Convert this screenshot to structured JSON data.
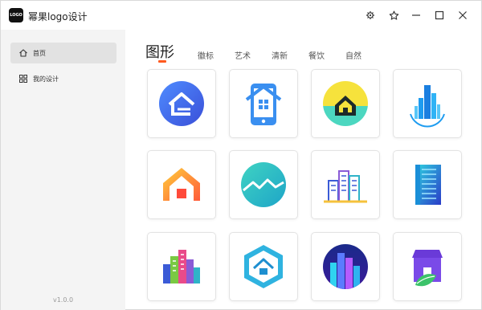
{
  "app": {
    "logo_text": "LOGO",
    "title": "幂果logo设计"
  },
  "titlebar": {
    "icons": [
      "settings-icon",
      "star-icon",
      "minimize-icon",
      "maximize-icon",
      "close-icon"
    ]
  },
  "sidebar": {
    "items": [
      {
        "label": "首页",
        "icon": "home-icon",
        "active": true
      },
      {
        "label": "我的设计",
        "icon": "grid-icon",
        "active": false
      }
    ],
    "version": "v1.0.0"
  },
  "tabs": [
    {
      "label": "图形",
      "active": true
    },
    {
      "label": "徽标"
    },
    {
      "label": "艺术"
    },
    {
      "label": "清新"
    },
    {
      "label": "餐饮"
    },
    {
      "label": "自然"
    }
  ],
  "colors": {
    "accent": "#ff5a1f",
    "sidebar_bg": "#f4f4f4",
    "active_item_bg": "#e2e2e2"
  },
  "templates": [
    {
      "icon": "house-circle-blue-icon"
    },
    {
      "icon": "phone-house-icon"
    },
    {
      "icon": "house-circle-yellow-icon"
    },
    {
      "icon": "skyscraper-blue-icon"
    },
    {
      "icon": "house-gradient-orange-icon"
    },
    {
      "icon": "mountain-roofs-circle-icon"
    },
    {
      "icon": "city-buildings-line-icon"
    },
    {
      "icon": "tall-building-blue-icon"
    },
    {
      "icon": "colorful-city-icon"
    },
    {
      "icon": "hexagon-house-icon"
    },
    {
      "icon": "city-night-circle-icon"
    },
    {
      "icon": "shop-leaf-icon"
    }
  ]
}
